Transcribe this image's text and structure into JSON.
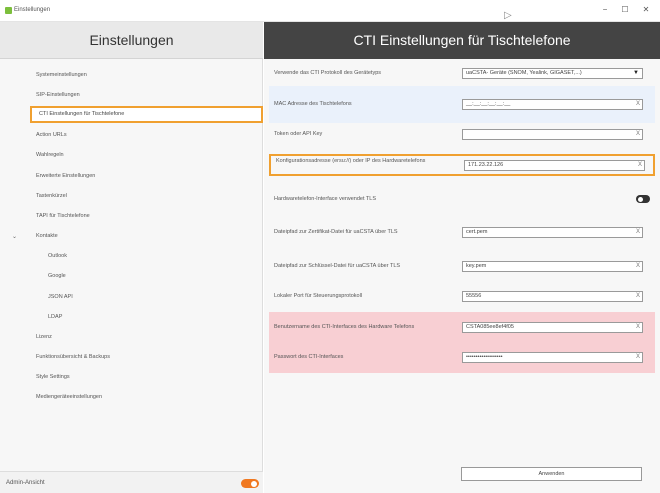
{
  "window": {
    "title": "Einstellungen",
    "controls": {
      "minimize": "−",
      "maximize": "☐",
      "close": "✕"
    }
  },
  "sidebar": {
    "header": "Einstellungen",
    "items": [
      {
        "label": "Systemeinstellungen"
      },
      {
        "label": "SIP-Einstellungen"
      },
      {
        "label": "CTI Einstellungen für Tischtelefone",
        "active": true
      },
      {
        "label": "Action URLs"
      },
      {
        "label": "Wahlregeln"
      },
      {
        "label": "Erweiterte Einstellungen"
      },
      {
        "label": "Tastenkürzel"
      },
      {
        "label": "TAPI für Tischtelefone"
      },
      {
        "label": "Kontakte",
        "expandable": true,
        "chevron": "⌄"
      },
      {
        "label": "Outlook",
        "sub": true
      },
      {
        "label": "Google",
        "sub": true
      },
      {
        "label": "JSON API",
        "sub": true
      },
      {
        "label": "LDAP",
        "sub": true
      },
      {
        "label": "Lizenz"
      },
      {
        "label": "Funktionsübersicht & Backups"
      },
      {
        "label": "Style Settings"
      },
      {
        "label": "Mediengeräteeinstellungen"
      }
    ],
    "footer": {
      "label": "Admin-Ansicht",
      "toggle_on": true
    }
  },
  "main": {
    "title": "CTI Einstellungen für Tischtelefone",
    "fields": [
      {
        "label": "Verwende das CTI Protokoll des Gerätetyps",
        "value": "uaCSTA- Geräte (SNOM, Yealink, GIGASET,...)",
        "type": "select",
        "caret": "▼"
      },
      {
        "label": "MAC Adresse des Tischtelefons",
        "value": "__:__:__:__:__:__",
        "type": "text",
        "clear": "X"
      },
      {
        "label": "Token oder API Key",
        "value": "",
        "type": "text",
        "clear": "X"
      },
      {
        "label": "Konfigurationsadresse (ersu://) oder IP des Hardwaretelefons",
        "value": "171.23.22.126",
        "type": "text",
        "clear": "X"
      },
      {
        "label": "Hardwaretelefon-Interface verwendet TLS",
        "type": "toggle",
        "on": true
      },
      {
        "label": "Dateipfad zur Zertifikat-Datei für uaCSTA über TLS",
        "value": "cert.pem",
        "type": "text",
        "clear": "X"
      },
      {
        "label": "Dateipfad zur Schlüssel-Datei für uaCSTA über TLS",
        "value": "key.pem",
        "type": "text",
        "clear": "X"
      },
      {
        "label": "Lokaler Port für Steuerungsprotokoll",
        "value": "55556",
        "type": "text",
        "clear": "X"
      },
      {
        "label": "Benutzername des CTI-Interfaces des Hardware Telefons",
        "value": "CSTA085ee8ef4f05",
        "type": "text",
        "clear": "X"
      },
      {
        "label": "Passwort des CTI-Interfaces",
        "value": "•••••••••••••••••••",
        "type": "password",
        "clear": "X"
      }
    ],
    "apply_label": "Anwenden"
  },
  "colors": {
    "accent_orange": "#f07820",
    "highlight_orange": "#f0a030",
    "header_dark": "#444444",
    "row_blue": "#eaf1fb",
    "row_pink": "#f8cfd3"
  }
}
